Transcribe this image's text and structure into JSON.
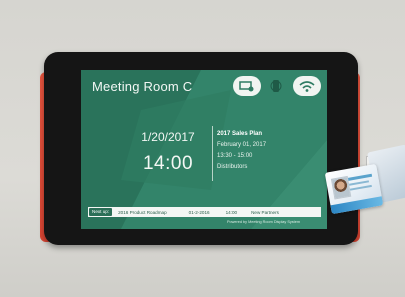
{
  "room": {
    "name": "Meeting Room C"
  },
  "current": {
    "date": "1/20/2017",
    "time": "14:00"
  },
  "meeting": {
    "title": "2017 Sales Plan",
    "date": "February 01, 2017",
    "time_range": "13:30  -  15:00",
    "audience": "Distributors"
  },
  "next": {
    "label": "Next up:",
    "title": "2016 Product Roadmap",
    "date": "01-2-2016",
    "time": "14:00",
    "attendees": "New Partners"
  },
  "footer": {
    "powered": "Powered by Meeting Room Display System"
  },
  "icons": [
    "projector-icon",
    "phone-icon",
    "wifi-icon"
  ],
  "colors": {
    "screen": "#2e7b62",
    "frame": "#151515",
    "led": "#e8553f"
  }
}
